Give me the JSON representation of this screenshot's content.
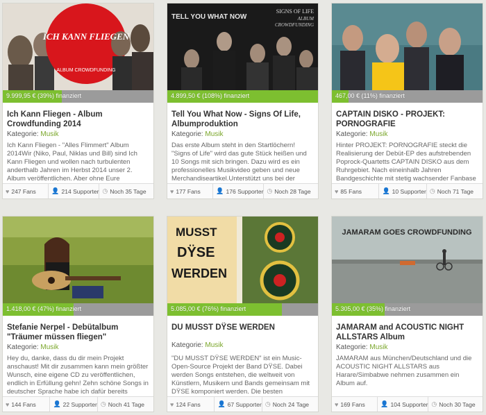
{
  "colors": {
    "accent": "#7dbf30",
    "link": "#7aa62a",
    "bar_bg": "#9b9b9b"
  },
  "category_label": "Kategorie:",
  "cards": [
    {
      "progress_text": "9.999,95 € (39%) finanziert",
      "progress": 0.39,
      "title": "Ich Kann Fliegen - Album Crowdfunding 2014",
      "category": "Musik",
      "description": "Ich Kann Fliegen - \"Alles Flimmert\" Album 2014Wir (Niko, Paul, Niklas und Bill) sind Ich Kann Fliegen und wollen nach turbulenten anderthalb Jahren im Herbst 2014 unser 2. Album veröffentlichen. Aber ohne Eure",
      "fans": "247 Fans",
      "supporter": "214 Supporter",
      "days": "Noch 35 Tage",
      "image_logo_text": "ICH KANN FLIEGEN",
      "image_caption": "ALBUM CROWDFUNDING"
    },
    {
      "progress_text": "4.899,50 € (108%) finanziert",
      "progress": 1.0,
      "title": "Tell You What Now - Signs Of Life, Albumproduktion",
      "category": "Musik",
      "description": "Das erste Album steht in den Startlöchern! \"Signs of Life\" wird das gute Stück heißen und 10 Songs mit sich bringen. Dazu wird es ein professionelles Musikvideo geben und neue Merchandiseartikel.Unterstützt uns bei der",
      "fans": "177 Fans",
      "supporter": "176 Supporter",
      "days": "Noch 28 Tage",
      "image_band_text": "TELL YOU WHAT NOW",
      "image_album_text": "SIGNS OF LIFE",
      "image_album_sub": "ALBUM",
      "image_album_sub2": "CROWDFUNDING"
    },
    {
      "progress_text": "467,00 € (11%) finanziert",
      "progress": 0.11,
      "title": "CAPTAIN DISKO - PROJEKT: PORNOGRAFIE",
      "category": "Musik",
      "description": "Hinter PROJEKT: PORNOGRAFIE steckt die Realisierung der Debüt-EP des aufstrebenden Poprock-Quartetts CAPTAIN DISKO aus dem Ruhrgebiet. Nach eineinhalb Jahren Bandgeschichte mit stetig wachsender Fanbase",
      "fans": "85 Fans",
      "supporter": "10 Supporter",
      "days": "Noch 71 Tage"
    },
    {
      "progress_text": "1.418,00 € (47%) finanziert",
      "progress": 0.47,
      "title": "Stefanie Nerpel - Debütalbum \"Träumer müssen fliegen\"",
      "category": "Musik",
      "description": "Hey du, danke, dass du dir mein Projekt anschaust! Mit dir zusammen kann mein größter Wunsch, eine eigene CD zu veröffentlichen, endlich in Erfüllung gehn! Zehn schöne Songs in deutscher Sprache habe ich dafür bereits",
      "fans": "144 Fans",
      "supporter": "22 Supporter",
      "days": "Noch 41 Tage"
    },
    {
      "progress_text": "5.085,00 € (76%) finanziert",
      "progress": 0.76,
      "title": "DU MUSST DŸSE WERDEN",
      "category": "Musik",
      "description": "\"DU MUSST DŸSE WERDEN\" ist ein Music-Open-Source Projekt der Band DŸSE. Dabei werden Songs entstehen, die weltweit von Künstlern, Musikern und Bands gemeinsam mit DŸSE komponiert werden. Die besten",
      "fans": "124 Fans",
      "supporter": "67 Supporter",
      "days": "Noch 24 Tage",
      "image_line1": "MUSST",
      "image_line2": "DŸSE",
      "image_line3": "WERDEN"
    },
    {
      "progress_text": "5.305,00 € (35%) finanziert",
      "progress": 0.35,
      "title": "JAMARAM and ACOUSTIC NIGHT ALLSTARS Album",
      "category": "Musik",
      "description": "JAMARAM aus München/Deutschland und die ACOUSTIC NIGHT ALLSTARS aus Harare/Simbabwe nehmen zusammen ein Album auf.",
      "fans": "169 Fans",
      "supporter": "104 Supporter",
      "days": "Noch 30 Tage",
      "image_heading": "JAMARAM GOES CROWDFUNDING"
    }
  ]
}
